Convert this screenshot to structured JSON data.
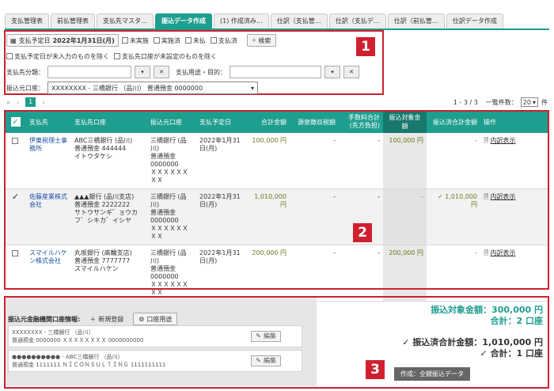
{
  "tabs": [
    {
      "label": "支払管理表",
      "active": false
    },
    {
      "label": "前払管理表",
      "active": false
    },
    {
      "label": "支払先マスタ…",
      "active": false
    },
    {
      "label": "振込データ作成",
      "active": true
    },
    {
      "label": "(1) 作成済み…",
      "active": false
    },
    {
      "label": "仕訳（支払管…",
      "active": false
    },
    {
      "label": "仕訳（支払デ…",
      "active": false
    },
    {
      "label": "仕訳（前払管…",
      "active": false
    },
    {
      "label": "仕訳データ作成",
      "active": false
    }
  ],
  "filter": {
    "date_label": "支払予定日",
    "date_value": "2022年1月31日(月)",
    "status_checks": [
      "未実施",
      "実施済",
      "未払",
      "支払済"
    ],
    "search_label": "検索",
    "exclude_unset_date": "支払予定日が未入力のものを除く",
    "exclude_unset_account": "支払先口座が未設定のものを除く",
    "category_label": "支払先分類：",
    "purpose_label": "支払用途・目的：",
    "source_account_label": "振込元口座：",
    "source_account_value": "XXXXXXXX - 三橋銀行 （品川） 普通預金 0000000"
  },
  "pager": {
    "first": "«",
    "prev": "‹",
    "current": "1",
    "next": "›",
    "range": "1 - 3 / 3",
    "per_page_label": "一覧件数：",
    "per_page_value": "20",
    "per_page_unit": "件"
  },
  "table": {
    "headers": [
      "支払先",
      "支払先口座",
      "振込元口座",
      "支払予定日",
      "合計金額",
      "源泉徴収税額",
      "手数料合計\n(先方負担)",
      "振込対象金額",
      "振込済合計金額",
      "操作"
    ],
    "rows": [
      {
        "checked": false,
        "payee": "伊東税理士事務所",
        "payee_account": "ABC三橋銀行 (品川)\n普通預金 444444\nイトウタケシ",
        "source_account": "三橋銀行 (品川)\n普通預金 0000000\nＸＸＸＸＸＸＸＸ",
        "date": "2022年1月31日(月)",
        "total": "100,000 円",
        "withholding": "-",
        "fee": "-",
        "target": "100,000 円",
        "transferred": "-",
        "action": "内訳表示"
      },
      {
        "checked": true,
        "payee": "佐藤産業株式会社",
        "payee_account": "▲▲▲銀行 (品川支店)\n普通預金 2222222\nサトウサンギ゛ョウカフ゛シキカ゛イシヤ",
        "source_account": "三橋銀行 (品川)\n普通預金 0000000\nＸＸＸＸＸＸＸＸ",
        "date": "2022年1月31日(月)",
        "total": "1,010,000 円",
        "withholding": "-",
        "fee": "-",
        "target": "-",
        "transferred": "✓ 1,010,000 円",
        "action": "内訳表示"
      },
      {
        "checked": false,
        "payee": "スマイルハケン株式会社",
        "payee_account": "丸坂銀行 (高輪支店)\n普通預金 7777777\nスマイルハケン",
        "source_account": "三橋銀行 (品川)\n普通預金 0000000\nＸＸＸＸＸＸＸＸ",
        "date": "2022年1月31日(月)",
        "total": "200,000 円",
        "withholding": "-",
        "fee": "-",
        "target": "200,000 円",
        "transferred": "-",
        "action": "内訳表示"
      }
    ]
  },
  "bank_info": {
    "title": "振込元金融機関口座情報:",
    "new_label": "新規登録",
    "usage_label": "口座用途",
    "accounts": [
      {
        "line1": "XXXXXXXX - 三橋銀行 （品川）",
        "line2": "普通預金 0000000 ＸＸＸＸＸＸＸＸ 0000000000",
        "edit": "編集"
      },
      {
        "line1": "●●●●●●●●●● - ABC三橋銀行 （品川）",
        "line2": "普通預金 1111111 ＮＩＣＯＮＳＵＬＴＩＮＧ 1111111111",
        "edit": "編集"
      }
    ]
  },
  "summary": {
    "target_amount": "振込対象金額：300,000 円",
    "target_count": "合計：2 口座",
    "transferred_amount": "✓ 振込済合計金額：1,010,000 円",
    "transferred_count": "✓ 合計：1 口座",
    "create_button": "作成：全銀振込データ"
  },
  "markers": [
    "1",
    "2",
    "3"
  ],
  "colors": {
    "accent": "#1e9e8e",
    "marker": "#d0202f"
  }
}
